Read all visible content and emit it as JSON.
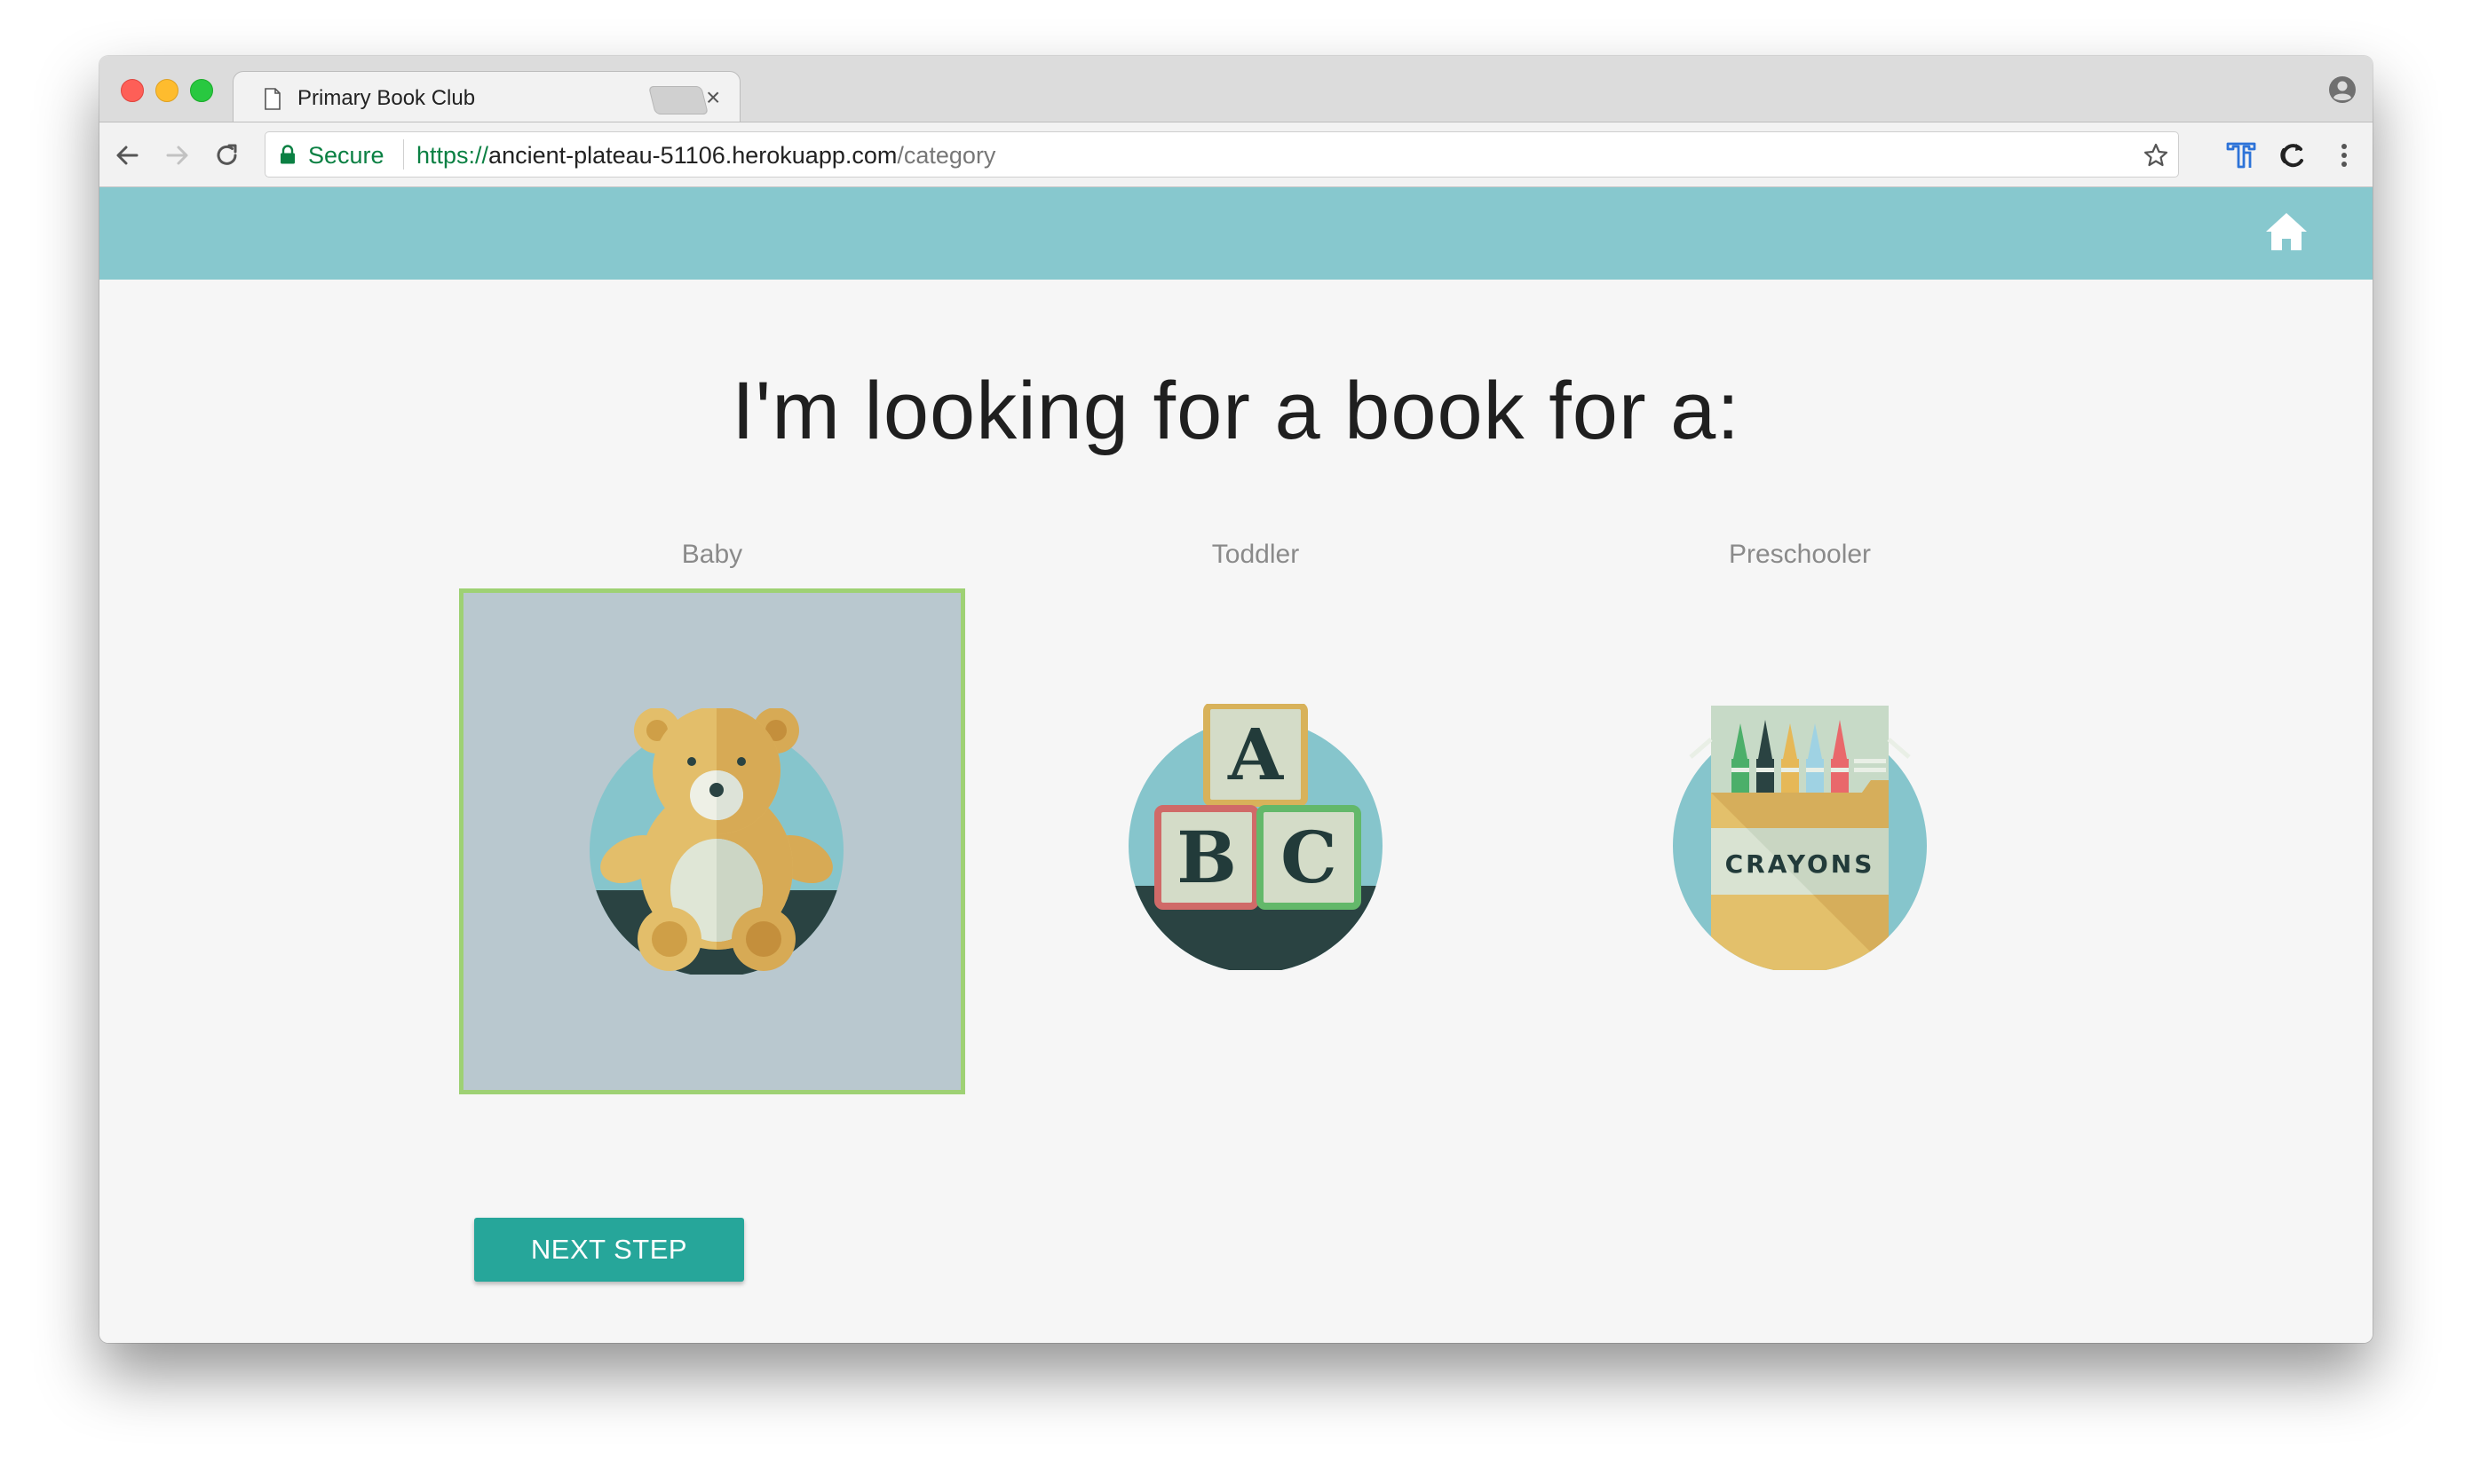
{
  "browser": {
    "tab_title": "Primary Book Club",
    "tab_close": "×",
    "secure_label": "Secure",
    "url_scheme": "https://",
    "url_host": "ancient-plateau-51106.herokuapp.com",
    "url_path": "/category"
  },
  "header": {
    "accent_color": "#87c8ce",
    "home_icon": "home-icon"
  },
  "main": {
    "title": "I'm looking for a book for a:",
    "categories": [
      {
        "label": "Baby",
        "icon": "teddy-bear-icon",
        "selected": true
      },
      {
        "label": "Toddler",
        "icon": "abc-blocks-icon",
        "selected": false
      },
      {
        "label": "Preschooler",
        "icon": "crayons-box-icon",
        "selected": false
      }
    ],
    "crayons_text": "CRAYONS",
    "toddler_blocks": [
      "A",
      "B",
      "C"
    ],
    "next_button": "NEXT STEP",
    "button_color": "#26a69a",
    "selected_border_color": "#9ed174"
  }
}
